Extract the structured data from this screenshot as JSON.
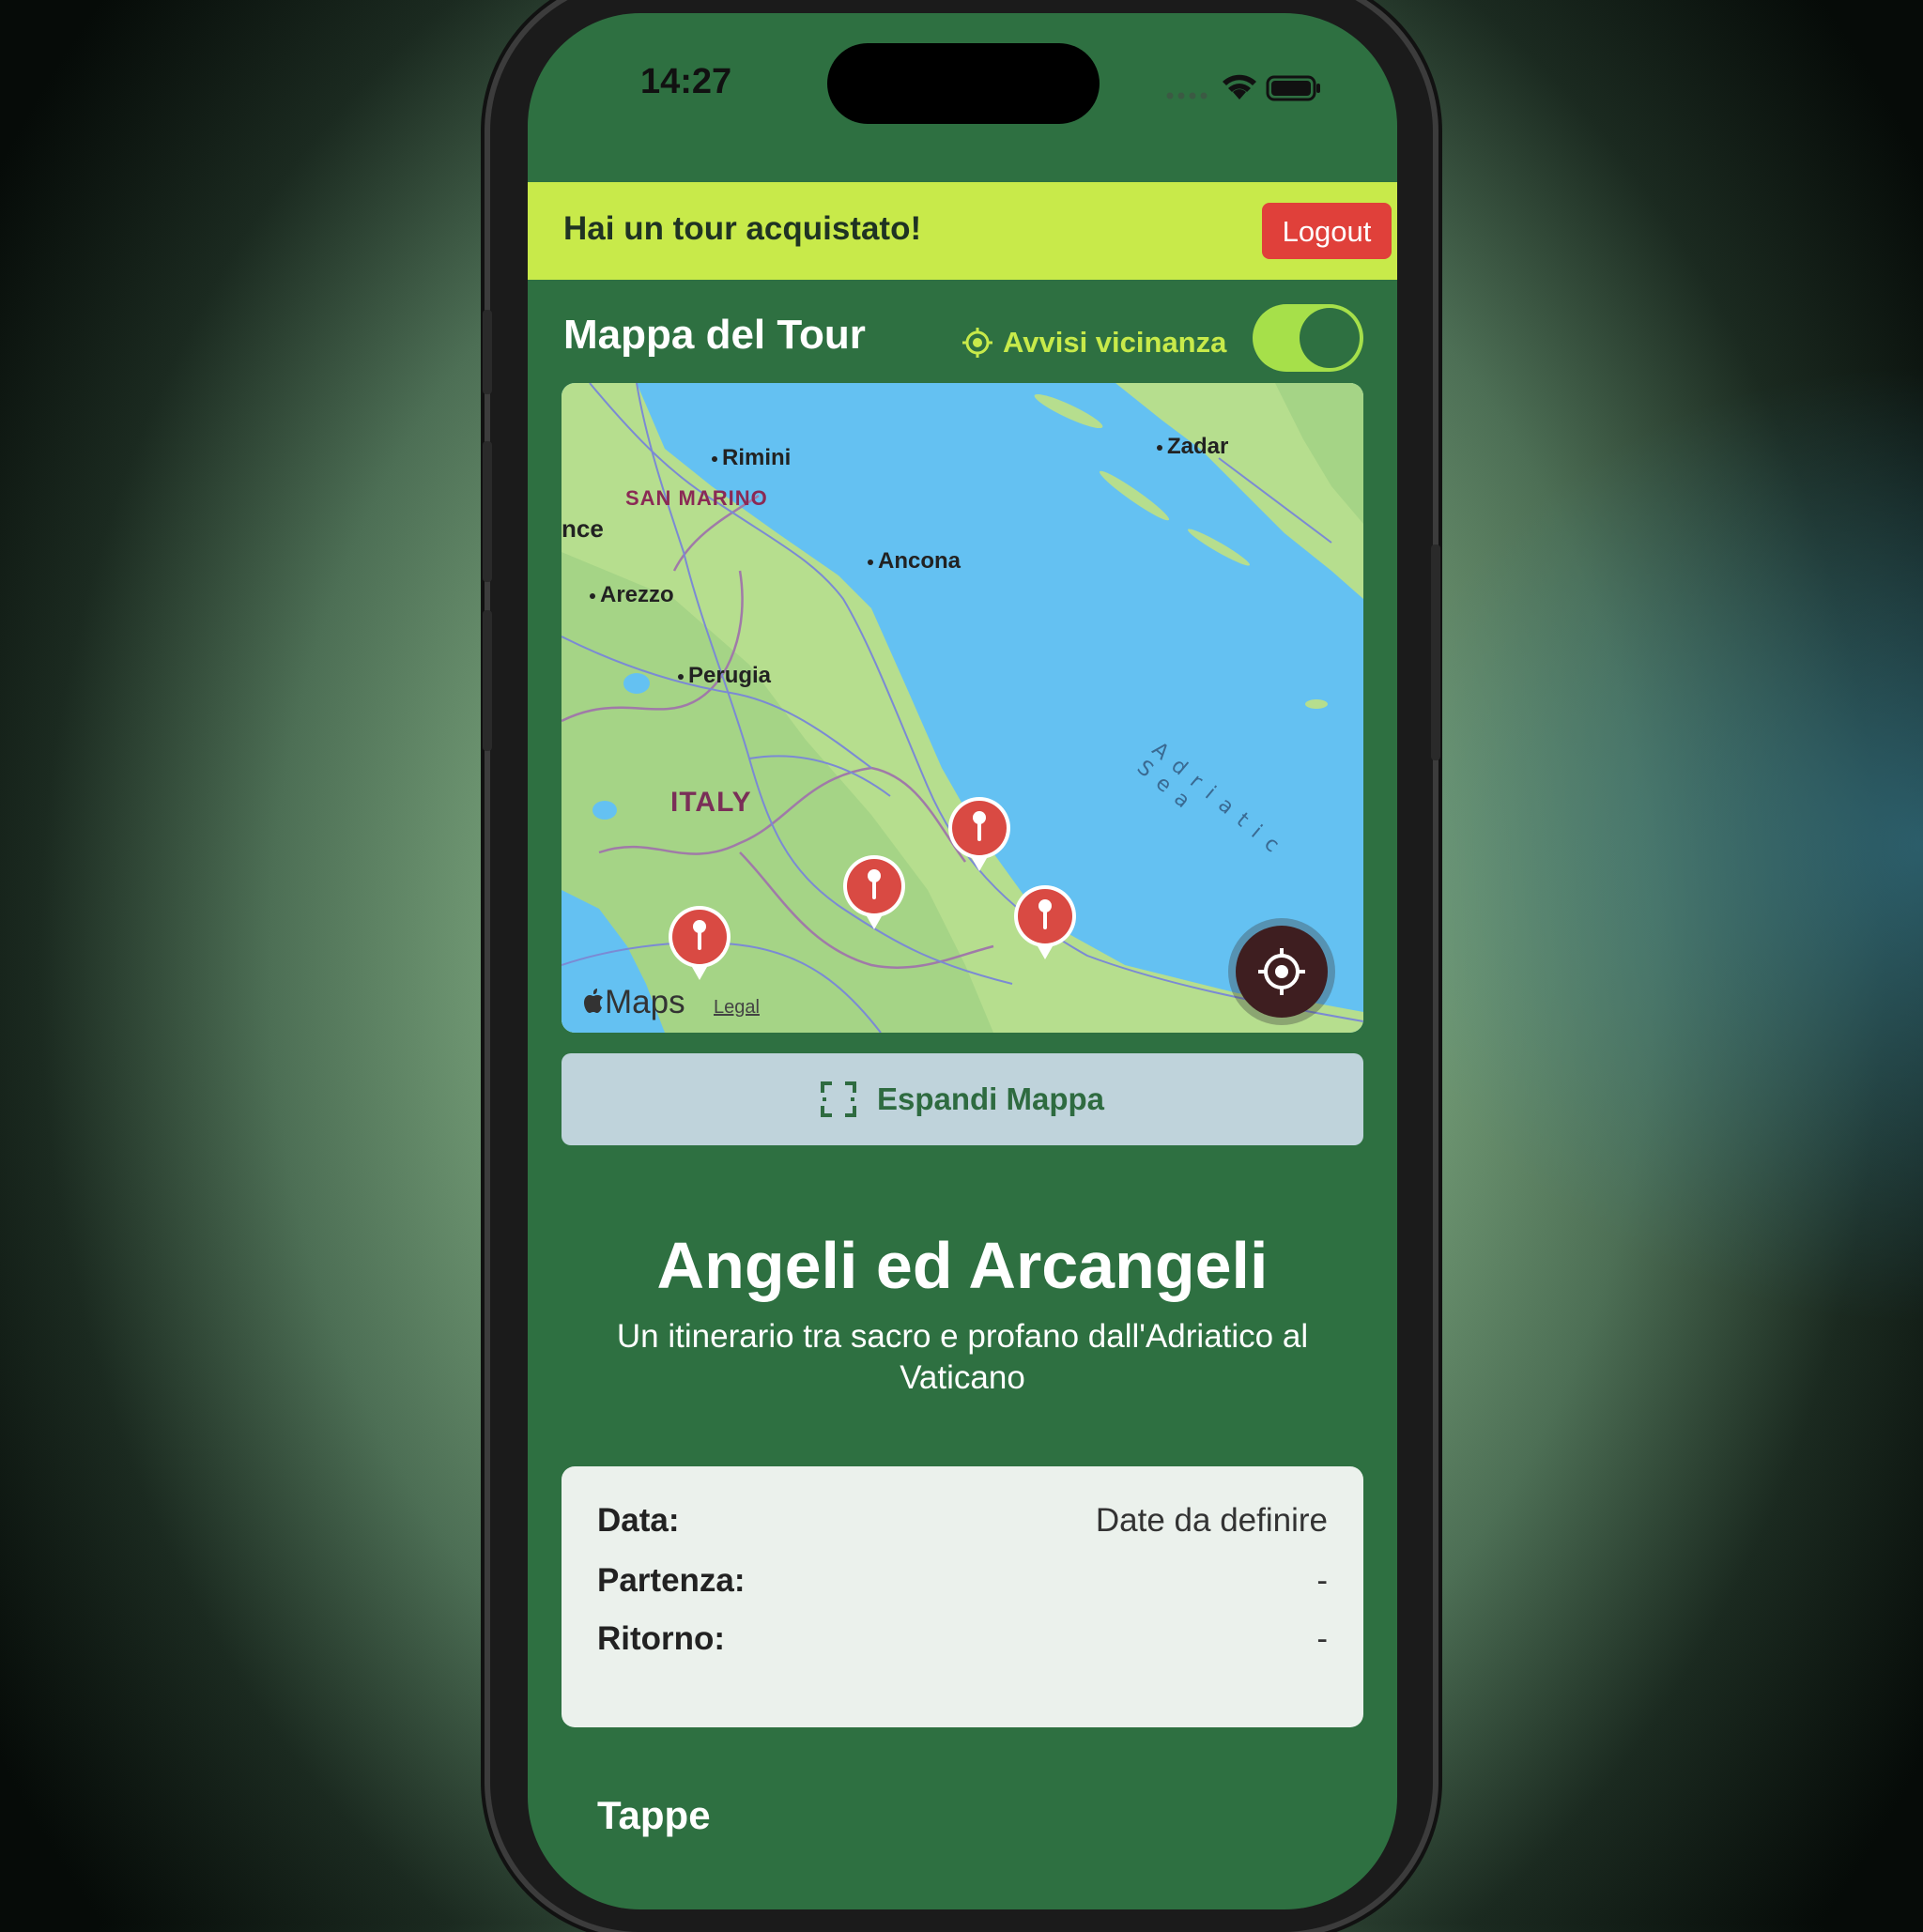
{
  "status_bar": {
    "time": "14:27"
  },
  "banner": {
    "text": "Hai un tour acquistato!",
    "logout_label": "Logout"
  },
  "map_section": {
    "title": "Mappa del Tour",
    "proximity_label": "Avvisi vicinanza",
    "proximity_enabled": true,
    "cities": [
      "Rimini",
      "Zadar",
      "Ancona",
      "Arezzo",
      "Perugia"
    ],
    "region_labels": {
      "san_marino": "SAN MARINO",
      "italy": "ITALY",
      "nce": "nce",
      "sea": "Adriatic Sea"
    },
    "attribution": {
      "maps": "Maps",
      "legal": "Legal"
    },
    "pin_count": 4,
    "expand_label": "Espandi Mappa"
  },
  "tour": {
    "title": "Angeli ed Arcangeli",
    "subtitle": "Un itinerario tra sacro e profano dall'Adriatico al Vaticano"
  },
  "details": {
    "date_label": "Data:",
    "date_value": "Date da definire",
    "departure_label": "Partenza:",
    "departure_value": "-",
    "return_label": "Ritorno:",
    "return_value": "-"
  },
  "stages": {
    "title": "Tappe"
  },
  "colors": {
    "app_green": "#2e7041",
    "banner_lime": "#c8ea4a",
    "logout_red": "#e0403a",
    "pin_red": "#d94a43"
  },
  "icons": [
    "apple-icon",
    "wifi-icon",
    "battery-icon",
    "location-target-icon",
    "expand-icon",
    "map-pin-icon",
    "crosshair-icon"
  ]
}
